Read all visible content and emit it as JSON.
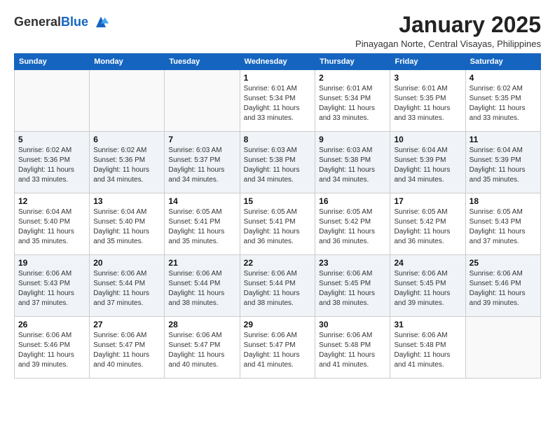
{
  "header": {
    "logo_general": "General",
    "logo_blue": "Blue",
    "title": "January 2025",
    "location": "Pinayagan Norte, Central Visayas, Philippines"
  },
  "weekdays": [
    "Sunday",
    "Monday",
    "Tuesday",
    "Wednesday",
    "Thursday",
    "Friday",
    "Saturday"
  ],
  "weeks": [
    [
      {
        "day": "",
        "sunrise": "",
        "sunset": "",
        "daylight": ""
      },
      {
        "day": "",
        "sunrise": "",
        "sunset": "",
        "daylight": ""
      },
      {
        "day": "",
        "sunrise": "",
        "sunset": "",
        "daylight": ""
      },
      {
        "day": "1",
        "sunrise": "Sunrise: 6:01 AM",
        "sunset": "Sunset: 5:34 PM",
        "daylight": "Daylight: 11 hours and 33 minutes."
      },
      {
        "day": "2",
        "sunrise": "Sunrise: 6:01 AM",
        "sunset": "Sunset: 5:34 PM",
        "daylight": "Daylight: 11 hours and 33 minutes."
      },
      {
        "day": "3",
        "sunrise": "Sunrise: 6:01 AM",
        "sunset": "Sunset: 5:35 PM",
        "daylight": "Daylight: 11 hours and 33 minutes."
      },
      {
        "day": "4",
        "sunrise": "Sunrise: 6:02 AM",
        "sunset": "Sunset: 5:35 PM",
        "daylight": "Daylight: 11 hours and 33 minutes."
      }
    ],
    [
      {
        "day": "5",
        "sunrise": "Sunrise: 6:02 AM",
        "sunset": "Sunset: 5:36 PM",
        "daylight": "Daylight: 11 hours and 33 minutes."
      },
      {
        "day": "6",
        "sunrise": "Sunrise: 6:02 AM",
        "sunset": "Sunset: 5:36 PM",
        "daylight": "Daylight: 11 hours and 34 minutes."
      },
      {
        "day": "7",
        "sunrise": "Sunrise: 6:03 AM",
        "sunset": "Sunset: 5:37 PM",
        "daylight": "Daylight: 11 hours and 34 minutes."
      },
      {
        "day": "8",
        "sunrise": "Sunrise: 6:03 AM",
        "sunset": "Sunset: 5:38 PM",
        "daylight": "Daylight: 11 hours and 34 minutes."
      },
      {
        "day": "9",
        "sunrise": "Sunrise: 6:03 AM",
        "sunset": "Sunset: 5:38 PM",
        "daylight": "Daylight: 11 hours and 34 minutes."
      },
      {
        "day": "10",
        "sunrise": "Sunrise: 6:04 AM",
        "sunset": "Sunset: 5:39 PM",
        "daylight": "Daylight: 11 hours and 34 minutes."
      },
      {
        "day": "11",
        "sunrise": "Sunrise: 6:04 AM",
        "sunset": "Sunset: 5:39 PM",
        "daylight": "Daylight: 11 hours and 35 minutes."
      }
    ],
    [
      {
        "day": "12",
        "sunrise": "Sunrise: 6:04 AM",
        "sunset": "Sunset: 5:40 PM",
        "daylight": "Daylight: 11 hours and 35 minutes."
      },
      {
        "day": "13",
        "sunrise": "Sunrise: 6:04 AM",
        "sunset": "Sunset: 5:40 PM",
        "daylight": "Daylight: 11 hours and 35 minutes."
      },
      {
        "day": "14",
        "sunrise": "Sunrise: 6:05 AM",
        "sunset": "Sunset: 5:41 PM",
        "daylight": "Daylight: 11 hours and 35 minutes."
      },
      {
        "day": "15",
        "sunrise": "Sunrise: 6:05 AM",
        "sunset": "Sunset: 5:41 PM",
        "daylight": "Daylight: 11 hours and 36 minutes."
      },
      {
        "day": "16",
        "sunrise": "Sunrise: 6:05 AM",
        "sunset": "Sunset: 5:42 PM",
        "daylight": "Daylight: 11 hours and 36 minutes."
      },
      {
        "day": "17",
        "sunrise": "Sunrise: 6:05 AM",
        "sunset": "Sunset: 5:42 PM",
        "daylight": "Daylight: 11 hours and 36 minutes."
      },
      {
        "day": "18",
        "sunrise": "Sunrise: 6:05 AM",
        "sunset": "Sunset: 5:43 PM",
        "daylight": "Daylight: 11 hours and 37 minutes."
      }
    ],
    [
      {
        "day": "19",
        "sunrise": "Sunrise: 6:06 AM",
        "sunset": "Sunset: 5:43 PM",
        "daylight": "Daylight: 11 hours and 37 minutes."
      },
      {
        "day": "20",
        "sunrise": "Sunrise: 6:06 AM",
        "sunset": "Sunset: 5:44 PM",
        "daylight": "Daylight: 11 hours and 37 minutes."
      },
      {
        "day": "21",
        "sunrise": "Sunrise: 6:06 AM",
        "sunset": "Sunset: 5:44 PM",
        "daylight": "Daylight: 11 hours and 38 minutes."
      },
      {
        "day": "22",
        "sunrise": "Sunrise: 6:06 AM",
        "sunset": "Sunset: 5:44 PM",
        "daylight": "Daylight: 11 hours and 38 minutes."
      },
      {
        "day": "23",
        "sunrise": "Sunrise: 6:06 AM",
        "sunset": "Sunset: 5:45 PM",
        "daylight": "Daylight: 11 hours and 38 minutes."
      },
      {
        "day": "24",
        "sunrise": "Sunrise: 6:06 AM",
        "sunset": "Sunset: 5:45 PM",
        "daylight": "Daylight: 11 hours and 39 minutes."
      },
      {
        "day": "25",
        "sunrise": "Sunrise: 6:06 AM",
        "sunset": "Sunset: 5:46 PM",
        "daylight": "Daylight: 11 hours and 39 minutes."
      }
    ],
    [
      {
        "day": "26",
        "sunrise": "Sunrise: 6:06 AM",
        "sunset": "Sunset: 5:46 PM",
        "daylight": "Daylight: 11 hours and 39 minutes."
      },
      {
        "day": "27",
        "sunrise": "Sunrise: 6:06 AM",
        "sunset": "Sunset: 5:47 PM",
        "daylight": "Daylight: 11 hours and 40 minutes."
      },
      {
        "day": "28",
        "sunrise": "Sunrise: 6:06 AM",
        "sunset": "Sunset: 5:47 PM",
        "daylight": "Daylight: 11 hours and 40 minutes."
      },
      {
        "day": "29",
        "sunrise": "Sunrise: 6:06 AM",
        "sunset": "Sunset: 5:47 PM",
        "daylight": "Daylight: 11 hours and 41 minutes."
      },
      {
        "day": "30",
        "sunrise": "Sunrise: 6:06 AM",
        "sunset": "Sunset: 5:48 PM",
        "daylight": "Daylight: 11 hours and 41 minutes."
      },
      {
        "day": "31",
        "sunrise": "Sunrise: 6:06 AM",
        "sunset": "Sunset: 5:48 PM",
        "daylight": "Daylight: 11 hours and 41 minutes."
      },
      {
        "day": "",
        "sunrise": "",
        "sunset": "",
        "daylight": ""
      }
    ]
  ]
}
